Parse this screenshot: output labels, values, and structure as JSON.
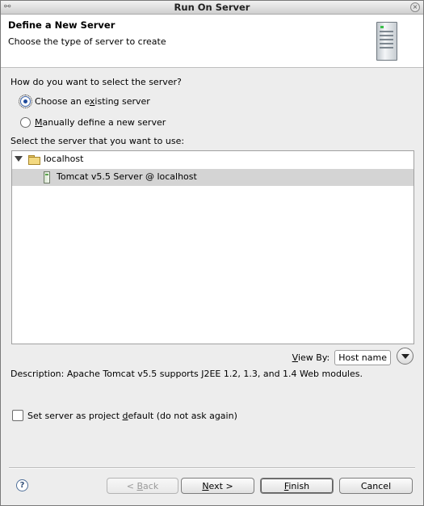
{
  "window": {
    "title": "Run On Server"
  },
  "header": {
    "title": "Define a New Server",
    "subtitle": "Choose the type of server to create",
    "icon": "server-tower-icon"
  },
  "selection": {
    "question": "How do you want to select the server?",
    "options": [
      {
        "pre": "Choose an e",
        "mnemonic": "x",
        "post": "isting server",
        "selected": true
      },
      {
        "pre": "",
        "mnemonic": "M",
        "post": "anually define a new server",
        "selected": false
      }
    ]
  },
  "server_list": {
    "label": "Select the server that you want to use:",
    "host": {
      "name": "localhost",
      "expanded": true
    },
    "servers": [
      {
        "name": "Tomcat v5.5 Server @ localhost",
        "selected": true
      }
    ]
  },
  "view_by": {
    "pre": "",
    "mnemonic": "V",
    "post": "iew By:",
    "value": "Host name"
  },
  "description": "Description: Apache Tomcat v5.5 supports J2EE 1.2, 1.3, and 1.4 Web modules.",
  "default_checkbox": {
    "pre": "Set server as project ",
    "mnemonic": "d",
    "post": "efault (do not ask again)",
    "checked": false
  },
  "buttons": {
    "help": "?",
    "back": {
      "pre": "< ",
      "mnemonic": "B",
      "post": "ack",
      "enabled": false
    },
    "next": {
      "pre": "",
      "mnemonic": "N",
      "post": "ext >"
    },
    "finish": {
      "pre": "",
      "mnemonic": "F",
      "post": "inish"
    },
    "cancel": "Cancel"
  }
}
